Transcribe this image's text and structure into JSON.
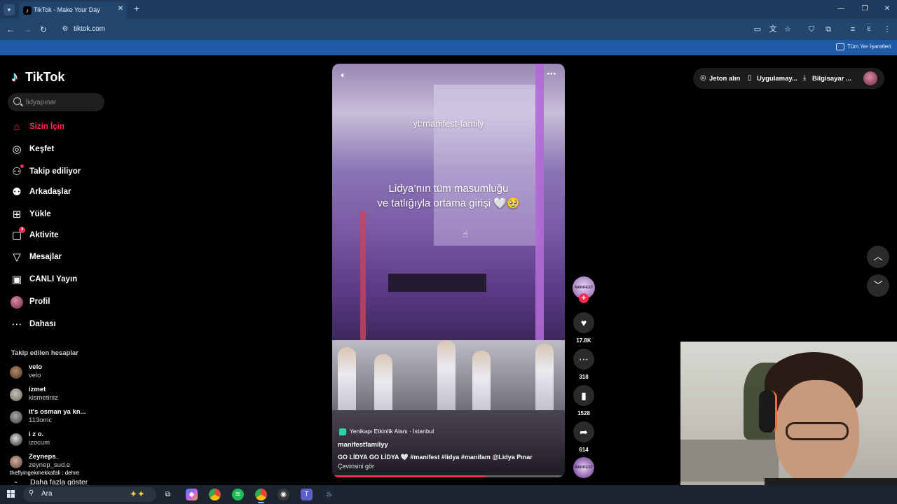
{
  "browser": {
    "tab_title": "TikTok - Make Your Day",
    "tab_favicon": "tiktok-favicon",
    "url": "tiktok.com",
    "profile_initial": "E",
    "bookmarks_label": "Tüm Yer İşaretleri"
  },
  "sidebar": {
    "brand": "TikTok",
    "search_placeholder": "lidyapınar",
    "nav": [
      {
        "label": "Sizin İçin",
        "icon": "home-icon",
        "active": true
      },
      {
        "label": "Keşfet",
        "icon": "compass-icon"
      },
      {
        "label": "Takip ediliyor",
        "icon": "following-icon",
        "dot": true
      },
      {
        "label": "Arkadaşlar",
        "icon": "friends-icon"
      },
      {
        "label": "Yükle",
        "icon": "upload-icon"
      },
      {
        "label": "Aktivite",
        "icon": "activity-icon",
        "badge": "3"
      },
      {
        "label": "Mesajlar",
        "icon": "messages-icon"
      },
      {
        "label": "CANLI Yayın",
        "icon": "live-icon"
      },
      {
        "label": "Profil",
        "icon": "profile-avatar"
      },
      {
        "label": "Dahası",
        "icon": "more-icon"
      }
    ],
    "following_title": "Takip edilen hesaplar",
    "following": [
      {
        "name": "velo",
        "username": "velo"
      },
      {
        "name": "izmet",
        "username": "kismetiniz"
      },
      {
        "name": "it's osman ya kn...",
        "username": "113omc"
      },
      {
        "name": "i z o.",
        "username": "izocum"
      },
      {
        "name": "Zeyneps_",
        "username": "zeynep_sud.e"
      }
    ],
    "chat_line": "theflyingekmekkafali : dehre",
    "see_more": "Daha fazla göster"
  },
  "video": {
    "watermark": "yt:manifest-family",
    "caption_line1": "Lidya’nın tüm masumluğu",
    "caption_line2": "ve tatlığıyla ortama girişi 🤍🥹",
    "location": "Yenikapı Etkinlik Alanı · İstanbul",
    "author": "manifestfamilyy",
    "description": "GO LİDYA GO LİDYA 🤍 #manifest #lidya #manifam @Lidya Pınar",
    "translate": "Çevirisini gör",
    "progress": 0.66,
    "creator_avatar_text": "MANIFEST",
    "music_disc_text": "MANIFEST"
  },
  "actions": {
    "likes": "17.8K",
    "comments": "318",
    "saves": "1528",
    "shares": "614"
  },
  "header": {
    "coins": "Jeton alın",
    "app": "Uygulamay...",
    "desktop": "Bilgisayar ..."
  },
  "taskbar": {
    "search_label": "Ara",
    "apps": [
      "task-view",
      "copilot",
      "chrome",
      "spotify",
      "chrome-profile",
      "obs",
      "teams",
      "steam"
    ]
  },
  "colors": {
    "accent": "#fe2c55",
    "chrome_tab": "#1e3a5c",
    "bookmarks_bar": "#1e5aa8"
  }
}
